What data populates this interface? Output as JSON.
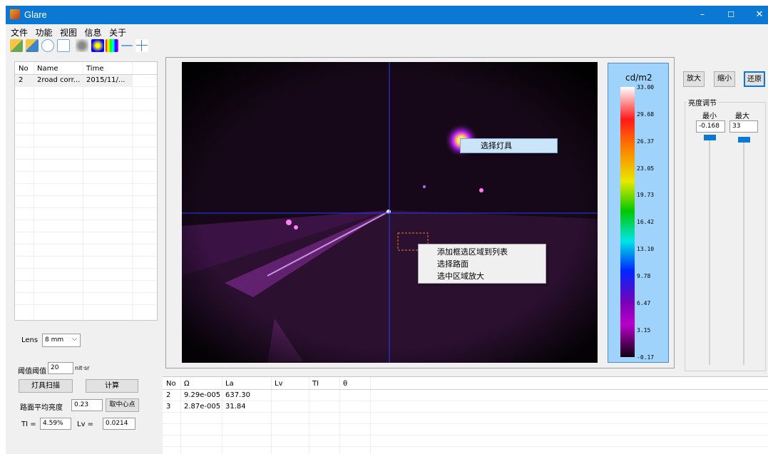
{
  "window": {
    "title": "Glare",
    "minimize": "–",
    "maximize": "☐",
    "close": "✕"
  },
  "menu": [
    "文件",
    "功能",
    "视图",
    "信息",
    "关于"
  ],
  "toolbar": {
    "icons": [
      "open-image-icon",
      "edit-icon",
      "ellipse-select-icon",
      "rect-select-icon",
      "grayscale-icon",
      "pseudocolor-icon",
      "colormap-icon",
      "line-tool-icon",
      "crosshair-icon"
    ]
  },
  "file_list": {
    "columns": [
      "No",
      "Name",
      "Time"
    ],
    "rows": [
      {
        "no": "2",
        "name": "2road corr...",
        "time": "2015/11/..."
      }
    ]
  },
  "controls": {
    "lens_label": "Lens",
    "lens_value": "8 mm",
    "threshold_label": "阈值阈值",
    "threshold_value": "20",
    "threshold_unit": "nit·sr",
    "scan_button": "灯具扫描",
    "calc_button": "计算",
    "road_avg_label": "路面平均亮度",
    "road_avg_value": "0.23",
    "center_button": "取中心点",
    "ti_label": "TI =",
    "ti_value": "4.59%",
    "lv_label": "Lv =",
    "lv_value": "0.0214"
  },
  "image_context_menu": {
    "select_lamp": "选择灯具"
  },
  "road_context_menu": {
    "items": [
      "添加框选区域到列表",
      "选择路面",
      "选中区域放大"
    ]
  },
  "colorbar": {
    "unit": "cd/m2",
    "ticks": [
      "33.00",
      "29.68",
      "26.37",
      "23.05",
      "19.73",
      "16.42",
      "13.10",
      "9.78",
      "6.47",
      "3.15",
      "-0.17"
    ]
  },
  "zoom_buttons": {
    "zoom_in": "放大",
    "zoom_out": "缩小",
    "restore": "还原"
  },
  "brightness": {
    "group_title": "亮度调节",
    "min_label": "最小",
    "max_label": "最大",
    "min_value": "-0.168",
    "max_value": "33"
  },
  "results": {
    "columns": [
      "No",
      "Ω",
      "La",
      "Lv",
      "TI",
      "θ"
    ],
    "rows": [
      {
        "no": "2",
        "omega": "9.29e-005",
        "la": "637.30"
      },
      {
        "no": "3",
        "omega": "2.87e-005",
        "la": "31.84"
      }
    ]
  },
  "colors": {
    "titlebar": "#0b78d4",
    "colorbar_panel": "#9fd3fb",
    "photo_bg": "#1a0a1f",
    "crosshair": "#2a3cff",
    "selection_highlight": "#cce4f7"
  }
}
